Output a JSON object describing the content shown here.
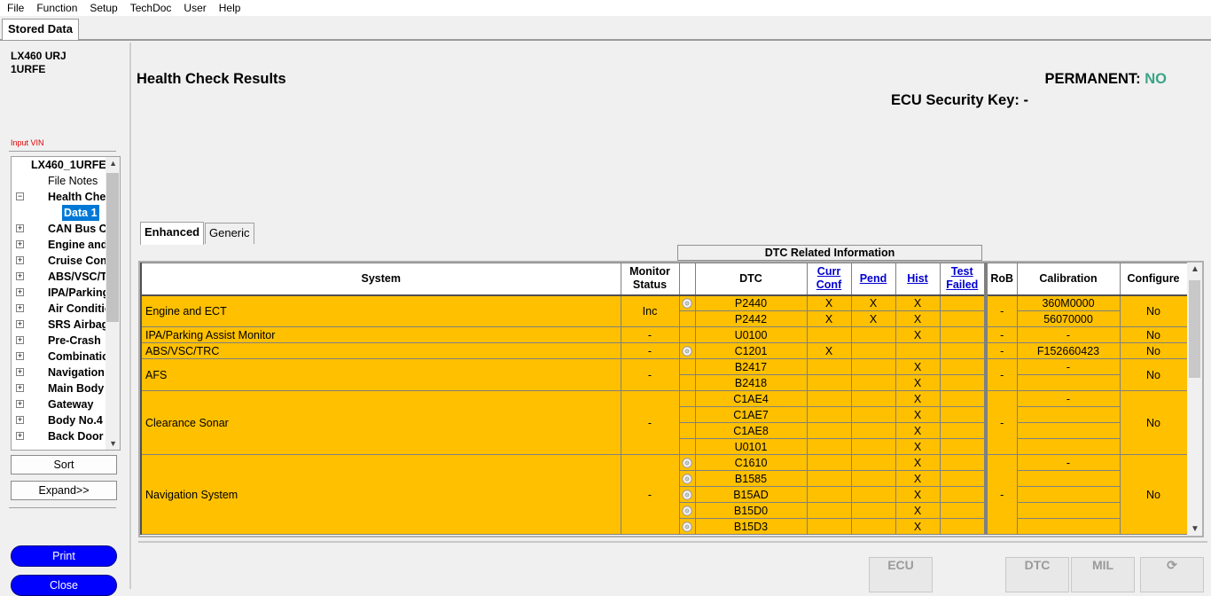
{
  "menu": [
    "File",
    "Function",
    "Setup",
    "TechDoc",
    "User",
    "Help"
  ],
  "tab": "Stored Data",
  "vehicle": {
    "model": "LX460 URJ",
    "engine": "1URFE"
  },
  "input_vin": "Input VIN",
  "tree": {
    "root": "LX460_1URFE",
    "file_notes": "File Notes",
    "health_check": "Health Check",
    "data_item": "Data 1",
    "items": [
      "CAN Bus Check",
      "Engine and ECT",
      "Cruise Control",
      "ABS/VSC/TRC",
      "IPA/Parking Assist Monitor",
      "Air Conditioner",
      "SRS Airbag",
      "Pre-Crash",
      "Combination Meter",
      "Navigation System",
      "Main Body",
      "Gateway",
      "Body No.4",
      "Back Door"
    ]
  },
  "buttons": {
    "sort": "Sort",
    "expand": "Expand>>",
    "print": "Print",
    "close": "Close"
  },
  "main": {
    "title": "Health Check Results",
    "permanent_label": "PERMANENT:",
    "permanent_value": "NO",
    "security_key": "ECU Security Key: -"
  },
  "subtabs": [
    "Enhanced",
    "Generic"
  ],
  "dtc_related_info": "DTC Related Information",
  "headers": {
    "system": "System",
    "monitor_status": "Monitor Status",
    "dtc": "DTC",
    "curr_conf": "Curr Conf",
    "pend": "Pend",
    "hist": "Hist",
    "test_failed": "Test Failed",
    "rob": "RoB",
    "calibration": "Calibration",
    "configure": "Configure"
  },
  "systems": [
    {
      "name": "Engine and ECT",
      "monitor": "Inc",
      "rob": "-",
      "configure": "No",
      "rows": [
        {
          "icon": true,
          "dtc": "P2440",
          "curr": "X",
          "pend": "X",
          "hist": "X",
          "failed": "",
          "cal": "360M0000"
        },
        {
          "icon": false,
          "dtc": "P2442",
          "curr": "X",
          "pend": "X",
          "hist": "X",
          "failed": "",
          "cal": "56070000"
        }
      ]
    },
    {
      "name": "IPA/Parking Assist Monitor",
      "monitor": "-",
      "rob": "-",
      "configure": "No",
      "rows": [
        {
          "icon": false,
          "dtc": "U0100",
          "curr": "",
          "pend": "",
          "hist": "X",
          "failed": "",
          "cal": "-"
        }
      ]
    },
    {
      "name": "ABS/VSC/TRC",
      "monitor": "-",
      "rob": "-",
      "configure": "No",
      "rows": [
        {
          "icon": true,
          "dtc": "C1201",
          "curr": "X",
          "pend": "",
          "hist": "",
          "failed": "",
          "cal": "F152660423"
        }
      ]
    },
    {
      "name": "AFS",
      "monitor": "-",
      "rob": "-",
      "configure": "No",
      "rows": [
        {
          "icon": false,
          "dtc": "B2417",
          "curr": "",
          "pend": "",
          "hist": "X",
          "failed": "",
          "cal": "-"
        },
        {
          "icon": false,
          "dtc": "B2418",
          "curr": "",
          "pend": "",
          "hist": "X",
          "failed": "",
          "cal": ""
        }
      ]
    },
    {
      "name": "Clearance Sonar",
      "monitor": "-",
      "rob": "-",
      "configure": "No",
      "rows": [
        {
          "icon": false,
          "dtc": "C1AE4",
          "curr": "",
          "pend": "",
          "hist": "X",
          "failed": "",
          "cal": "-"
        },
        {
          "icon": false,
          "dtc": "C1AE7",
          "curr": "",
          "pend": "",
          "hist": "X",
          "failed": "",
          "cal": ""
        },
        {
          "icon": false,
          "dtc": "C1AE8",
          "curr": "",
          "pend": "",
          "hist": "X",
          "failed": "",
          "cal": ""
        },
        {
          "icon": false,
          "dtc": "U0101",
          "curr": "",
          "pend": "",
          "hist": "X",
          "failed": "",
          "cal": ""
        }
      ]
    },
    {
      "name": "Navigation System",
      "monitor": "-",
      "rob": "-",
      "configure": "No",
      "rows": [
        {
          "icon": true,
          "dtc": "C1610",
          "curr": "",
          "pend": "",
          "hist": "X",
          "failed": "",
          "cal": "-"
        },
        {
          "icon": true,
          "dtc": "B1585",
          "curr": "",
          "pend": "",
          "hist": "X",
          "failed": "",
          "cal": ""
        },
        {
          "icon": true,
          "dtc": "B15AD",
          "curr": "",
          "pend": "",
          "hist": "X",
          "failed": "",
          "cal": ""
        },
        {
          "icon": true,
          "dtc": "B15D0",
          "curr": "",
          "pend": "",
          "hist": "X",
          "failed": "",
          "cal": ""
        },
        {
          "icon": true,
          "dtc": "B15D3",
          "curr": "",
          "pend": "",
          "hist": "X",
          "failed": "",
          "cal": ""
        }
      ]
    }
  ],
  "toolbar_icons": [
    {
      "name": "ecu-icon",
      "label": "ECU"
    },
    {
      "name": "dtc-timer-icon",
      "label": "DTC"
    },
    {
      "name": "mil-icon",
      "label": "MIL"
    },
    {
      "name": "refresh-icon",
      "label": ""
    }
  ],
  "colors": {
    "row_bg": "#ffc000",
    "permanent_value": "#3aa585",
    "primary_button": "#0000ff",
    "input_vin": "#e00000"
  }
}
